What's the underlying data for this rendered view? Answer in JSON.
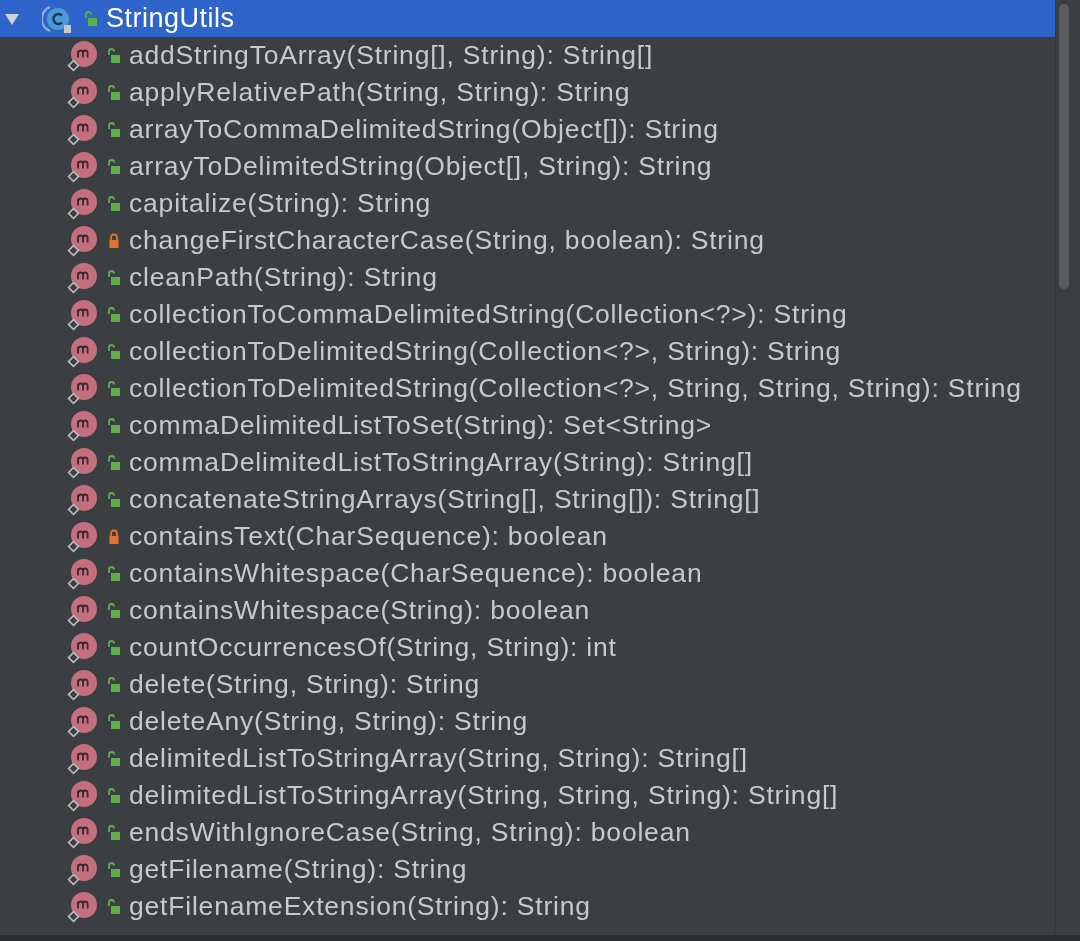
{
  "tree": {
    "root": {
      "label": "StringUtils",
      "expanded": true,
      "selected": true,
      "locked": false,
      "children": [
        {
          "label": "addStringToArray(String[], String): String[]",
          "locked": false,
          "selected": false
        },
        {
          "label": "applyRelativePath(String, String): String",
          "locked": false,
          "selected": false
        },
        {
          "label": "arrayToCommaDelimitedString(Object[]): String",
          "locked": false,
          "selected": false
        },
        {
          "label": "arrayToDelimitedString(Object[], String): String",
          "locked": false,
          "selected": false
        },
        {
          "label": "capitalize(String): String",
          "locked": false,
          "selected": false
        },
        {
          "label": "changeFirstCharacterCase(String, boolean): String",
          "locked": true,
          "selected": false
        },
        {
          "label": "cleanPath(String): String",
          "locked": false,
          "selected": false
        },
        {
          "label": "collectionToCommaDelimitedString(Collection<?>): String",
          "locked": false,
          "selected": false
        },
        {
          "label": "collectionToDelimitedString(Collection<?>, String): String",
          "locked": false,
          "selected": false
        },
        {
          "label": "collectionToDelimitedString(Collection<?>, String, String, String): String",
          "locked": false,
          "selected": false
        },
        {
          "label": "commaDelimitedListToSet(String): Set<String>",
          "locked": false,
          "selected": false
        },
        {
          "label": "commaDelimitedListToStringArray(String): String[]",
          "locked": false,
          "selected": false
        },
        {
          "label": "concatenateStringArrays(String[], String[]): String[]",
          "locked": false,
          "selected": false
        },
        {
          "label": "containsText(CharSequence): boolean",
          "locked": true,
          "selected": false
        },
        {
          "label": "containsWhitespace(CharSequence): boolean",
          "locked": false,
          "selected": false
        },
        {
          "label": "containsWhitespace(String): boolean",
          "locked": false,
          "selected": false
        },
        {
          "label": "countOccurrencesOf(String, String): int",
          "locked": false,
          "selected": false
        },
        {
          "label": "delete(String, String): String",
          "locked": false,
          "selected": false
        },
        {
          "label": "deleteAny(String, String): String",
          "locked": false,
          "selected": false
        },
        {
          "label": "delimitedListToStringArray(String, String): String[]",
          "locked": false,
          "selected": false
        },
        {
          "label": "delimitedListToStringArray(String, String, String): String[]",
          "locked": false,
          "selected": false
        },
        {
          "label": "endsWithIgnoreCase(String, String): boolean",
          "locked": false,
          "selected": false
        },
        {
          "label": "getFilename(String): String",
          "locked": false,
          "selected": false
        },
        {
          "label": "getFilenameExtension(String): String",
          "locked": false,
          "selected": false
        }
      ]
    }
  }
}
